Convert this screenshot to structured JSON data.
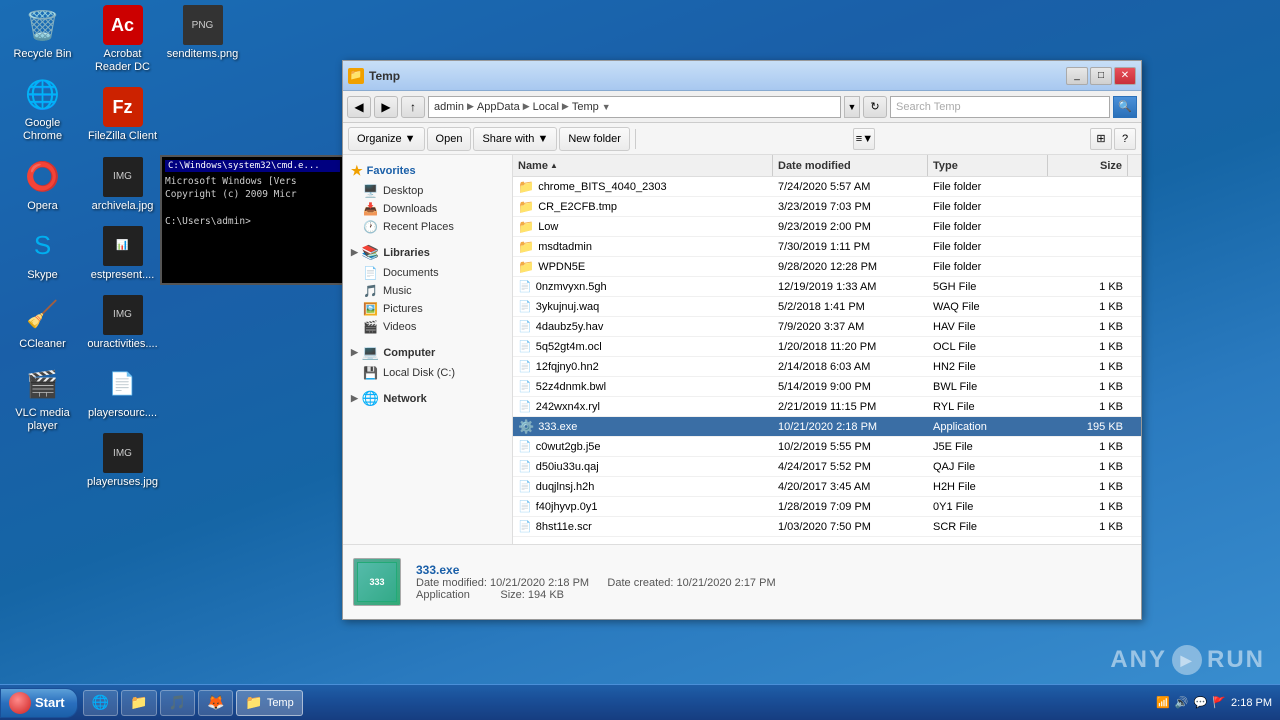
{
  "desktop": {
    "icons_col1": [
      {
        "id": "recycle-bin",
        "label": "Recycle Bin",
        "symbol": "🗑️"
      },
      {
        "id": "google-chrome",
        "label": "Google Chrome",
        "symbol": "🌐"
      },
      {
        "id": "opera",
        "label": "Opera",
        "symbol": "🔴"
      },
      {
        "id": "skype",
        "label": "Skype",
        "symbol": "💬"
      },
      {
        "id": "ccleaner",
        "label": "CCleaner",
        "symbol": "🧹"
      },
      {
        "id": "vlc",
        "label": "VLC media player",
        "symbol": "🎬"
      }
    ],
    "icons_col2": [
      {
        "id": "acrobat",
        "label": "Acrobat Reader DC",
        "symbol": "📄"
      },
      {
        "id": "filezilla",
        "label": "FileZilla Client",
        "symbol": "📡"
      },
      {
        "id": "archivela",
        "label": "archivela.jpg",
        "symbol": "🖼️"
      },
      {
        "id": "estpresent",
        "label": "estpresent....",
        "symbol": "📊"
      },
      {
        "id": "ouractivities",
        "label": "ouractivities....",
        "symbol": "🖼️"
      },
      {
        "id": "playersource",
        "label": "playersourc....",
        "symbol": "📄"
      },
      {
        "id": "playeruses",
        "label": "playeruses.jpg",
        "symbol": "🖼️"
      }
    ],
    "icons_col3": [
      {
        "id": "senditems",
        "label": "senditems.png",
        "symbol": "🖼️"
      }
    ]
  },
  "cmd_window": {
    "title": "C:\\Windows\\system32\\cmd.e...",
    "lines": [
      "Microsoft Windows [Vers",
      "Copyright (c) 2009 Micr",
      "",
      "C:\\Users\\admin>"
    ]
  },
  "explorer": {
    "title": "Temp",
    "title_icon": "📁",
    "address": {
      "parts": [
        "admin",
        "AppData",
        "Local",
        "Temp"
      ]
    },
    "search_placeholder": "Search Temp",
    "toolbar": {
      "organize": "Organize",
      "open": "Open",
      "share_with": "Share with",
      "new_folder": "New folder"
    },
    "nav_pane": {
      "favorites": {
        "header": "Favorites",
        "items": [
          {
            "id": "desktop",
            "label": "Desktop"
          },
          {
            "id": "downloads",
            "label": "Downloads"
          },
          {
            "id": "recent-places",
            "label": "Recent Places"
          }
        ]
      },
      "libraries": {
        "header": "Libraries",
        "items": [
          {
            "id": "documents",
            "label": "Documents"
          },
          {
            "id": "music",
            "label": "Music"
          },
          {
            "id": "pictures",
            "label": "Pictures"
          },
          {
            "id": "videos",
            "label": "Videos"
          }
        ]
      },
      "computer": {
        "header": "Computer",
        "items": [
          {
            "id": "local-disk",
            "label": "Local Disk (C:)"
          }
        ]
      },
      "network": {
        "header": "Network"
      }
    },
    "columns": {
      "name": "Name",
      "date_modified": "Date modified",
      "type": "Type",
      "size": "Size"
    },
    "files": [
      {
        "name": "chrome_BITS_4040_2303",
        "date": "7/24/2020 5:57 AM",
        "type": "File folder",
        "size": "",
        "is_folder": true
      },
      {
        "name": "CR_E2CFB.tmp",
        "date": "3/23/2019 7:03 PM",
        "type": "File folder",
        "size": "",
        "is_folder": true
      },
      {
        "name": "Low",
        "date": "9/23/2019 2:00 PM",
        "type": "File folder",
        "size": "",
        "is_folder": true
      },
      {
        "name": "msdtadmin",
        "date": "7/30/2019 1:11 PM",
        "type": "File folder",
        "size": "",
        "is_folder": true
      },
      {
        "name": "WPDN5E",
        "date": "9/28/2020 12:28 PM",
        "type": "File folder",
        "size": "",
        "is_folder": true
      },
      {
        "name": "0nzmvyxn.5gh",
        "date": "12/19/2019 1:33 AM",
        "type": "5GH File",
        "size": "1 KB",
        "is_folder": false
      },
      {
        "name": "3ykujnuj.waq",
        "date": "5/2/2018 1:41 PM",
        "type": "WAQ File",
        "size": "1 KB",
        "is_folder": false
      },
      {
        "name": "4daubz5y.hav",
        "date": "7/9/2020 3:37 AM",
        "type": "HAV File",
        "size": "1 KB",
        "is_folder": false
      },
      {
        "name": "5q52gt4m.ocl",
        "date": "1/20/2018 11:20 PM",
        "type": "OCL File",
        "size": "1 KB",
        "is_folder": false
      },
      {
        "name": "12fqjny0.hn2",
        "date": "2/14/2018 6:03 AM",
        "type": "HN2 File",
        "size": "1 KB",
        "is_folder": false
      },
      {
        "name": "52z4dnmk.bwl",
        "date": "5/14/2019 9:00 PM",
        "type": "BWL File",
        "size": "1 KB",
        "is_folder": false
      },
      {
        "name": "242wxn4x.ryl",
        "date": "2/21/2019 11:15 PM",
        "type": "RYL File",
        "size": "1 KB",
        "is_folder": false
      },
      {
        "name": "333.exe",
        "date": "10/21/2020 2:18 PM",
        "type": "Application",
        "size": "195 KB",
        "is_folder": false,
        "is_selected": true,
        "is_exe": true
      },
      {
        "name": "c0wut2gb.j5e",
        "date": "10/2/2019 5:55 PM",
        "type": "J5E File",
        "size": "1 KB",
        "is_folder": false
      },
      {
        "name": "d50iu33u.qaj",
        "date": "4/24/2017 5:52 PM",
        "type": "QAJ File",
        "size": "1 KB",
        "is_folder": false
      },
      {
        "name": "duqjlnsj.h2h",
        "date": "4/20/2017 3:45 AM",
        "type": "H2H File",
        "size": "1 KB",
        "is_folder": false
      },
      {
        "name": "f40jhyvp.0y1",
        "date": "1/28/2019 7:09 PM",
        "type": "0Y1 File",
        "size": "1 KB",
        "is_folder": false
      },
      {
        "name": "8hst11e.scr",
        "date": "1/03/2020 7:50 PM",
        "type": "SCR File",
        "size": "1 KB",
        "is_folder": false
      }
    ],
    "status": {
      "selected_name": "333.exe",
      "date_modified_label": "Date modified:",
      "date_modified_value": "10/21/2020 2:18 PM",
      "date_created_label": "Date created:",
      "date_created_value": "10/21/2020 2:17 PM",
      "type": "Application",
      "size_label": "Size:",
      "size_value": "194 KB"
    }
  },
  "taskbar": {
    "start_label": "Start",
    "items": [
      {
        "id": "ie",
        "label": "",
        "icon": "🌐"
      },
      {
        "id": "explorer",
        "label": "",
        "icon": "📁"
      },
      {
        "id": "media",
        "label": "",
        "icon": "🎵"
      },
      {
        "id": "firefox",
        "label": "",
        "icon": "🦊"
      }
    ],
    "active_window": "Temp",
    "tray_icons": [
      "🔊",
      "📶",
      "💬"
    ],
    "clock": "2:18 PM"
  },
  "anyrun": {
    "text": "ANY  RUN"
  }
}
